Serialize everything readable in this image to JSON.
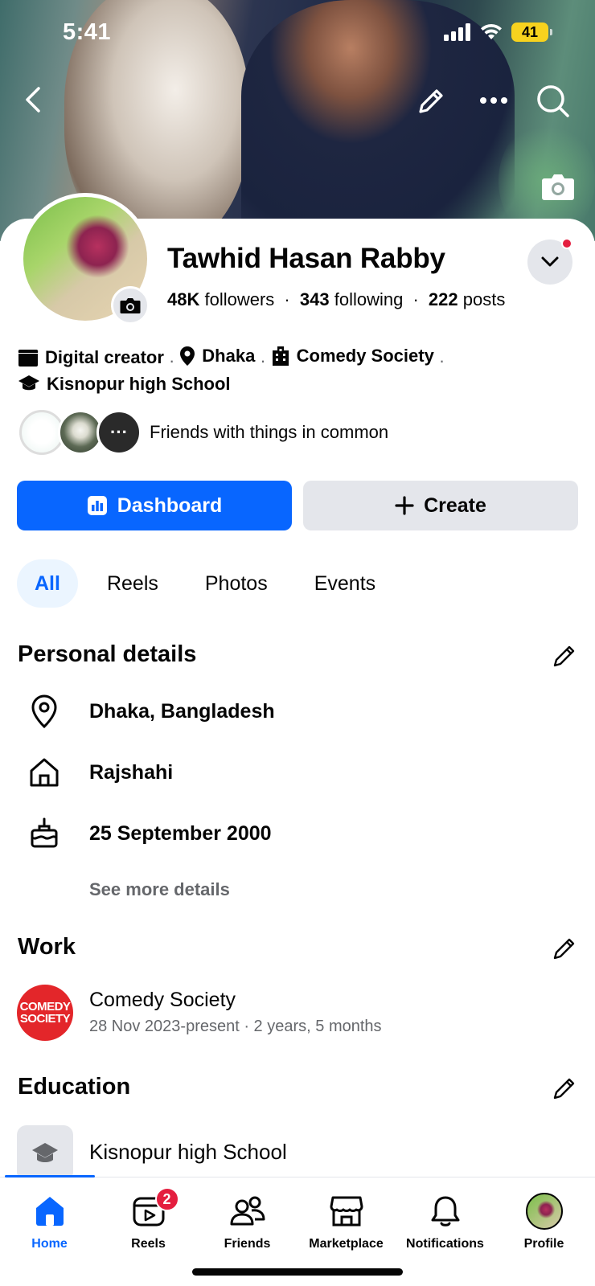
{
  "status_bar": {
    "time": "5:41",
    "battery": "41"
  },
  "profile": {
    "name": "Tawhid Hasan Rabby",
    "followers_count": "48K",
    "followers_label": "followers",
    "following_count": "343",
    "following_label": "following",
    "posts_count": "222",
    "posts_label": "posts"
  },
  "intro": {
    "category": "Digital creator",
    "city": "Dhaka",
    "workplace": "Comedy Society",
    "school": "Kisnopur high School"
  },
  "friends_row": {
    "text": "Friends with things in common",
    "more": "···"
  },
  "actions": {
    "dashboard": "Dashboard",
    "create": "Create"
  },
  "tabs": [
    "All",
    "Reels",
    "Photos",
    "Events"
  ],
  "personal_details": {
    "title": "Personal details",
    "location": "Dhaka, Bangladesh",
    "hometown": "Rajshahi",
    "birthday": "25 September 2000",
    "see_more": "See more details"
  },
  "work": {
    "title": "Work",
    "logo_line1": "COMEDY",
    "logo_line2": "SOCIETY",
    "company": "Comedy Society",
    "period": "28 Nov 2023-present · 2 years, 5 months"
  },
  "education": {
    "title": "Education",
    "school": "Kisnopur high School"
  },
  "bottom_nav": {
    "home": "Home",
    "reels": "Reels",
    "reels_badge": "2",
    "friends": "Friends",
    "marketplace": "Marketplace",
    "notifications": "Notifications",
    "profile": "Profile"
  },
  "colors": {
    "accent": "#0866ff",
    "badge": "#e41e3f",
    "secondary_text": "#65676b",
    "button_gray": "#e4e6eb"
  }
}
